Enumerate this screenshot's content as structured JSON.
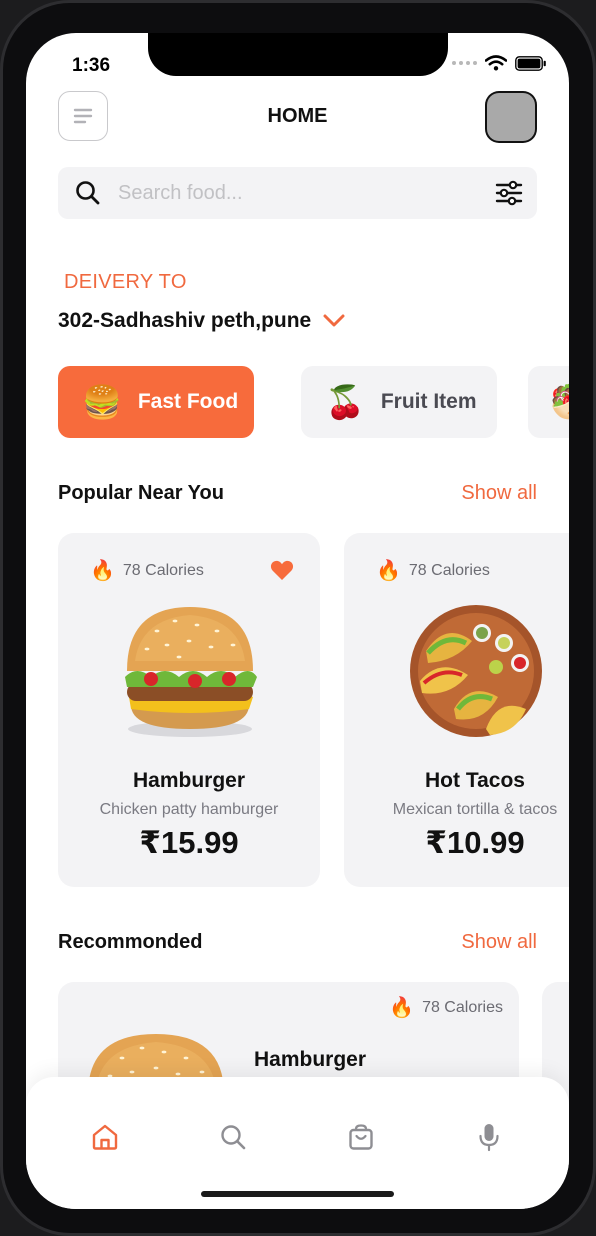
{
  "status_bar": {
    "time": "1:36"
  },
  "header": {
    "title": "HOME"
  },
  "search": {
    "placeholder": "Search food..."
  },
  "delivery": {
    "label": "DEIVERY TO",
    "address": "302-Sadhashiv peth,pune"
  },
  "categories": [
    {
      "label": "Fast Food",
      "icon": "burger-emoji",
      "active": true
    },
    {
      "label": "Fruit Item",
      "icon": "cherries-emoji",
      "active": false
    },
    {
      "label": "",
      "icon": "partial-chip-emoji",
      "active": false
    }
  ],
  "popular": {
    "title": "Popular Near You",
    "show_all": "Show all",
    "items": [
      {
        "calories": "78 Calories",
        "name": "Hamburger",
        "desc": "Chicken patty hamburger",
        "price": "₹15.99",
        "favorite": true
      },
      {
        "calories": "78 Calories",
        "name": "Hot Tacos",
        "desc": "Mexican tortilla & tacos",
        "price": "₹10.99",
        "favorite": false
      }
    ]
  },
  "recommended": {
    "title": "Recommonded",
    "show_all": "Show all",
    "items": [
      {
        "calories": "78 Calories",
        "name": "Hamburger"
      }
    ]
  },
  "tab_bar": {
    "items": [
      "home-icon",
      "search-icon",
      "cart-icon",
      "mic-icon"
    ],
    "active_index": 0
  },
  "colors": {
    "accent": "#f76b3c",
    "accent_text": "#f0693f",
    "card_bg": "#f3f3f5",
    "inactive_icon": "#8e8e93"
  }
}
